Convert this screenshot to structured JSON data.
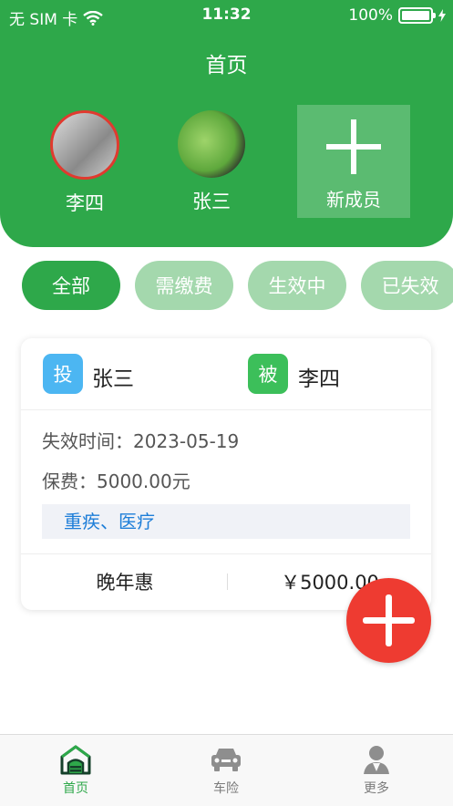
{
  "status_bar": {
    "carrier": "无 SIM 卡",
    "time": "11:32",
    "battery": "100%"
  },
  "header": {
    "title": "首页"
  },
  "members": [
    {
      "name": "李四"
    },
    {
      "name": "张三"
    }
  ],
  "add_member": {
    "label": "新成员"
  },
  "filters": [
    "全部",
    "需缴费",
    "生效中",
    "已失效"
  ],
  "policy_card": {
    "policyholder_badge": "投",
    "policyholder": "张三",
    "insured_badge": "被",
    "insured": "李四",
    "expiry": "失效时间：2023-05-19",
    "premium": "保费：5000.00元",
    "coverage": "重疾、医疗",
    "plan_name": "晚年惠",
    "price": "￥5000.00"
  },
  "tabbar": [
    {
      "label": "首页",
      "icon": "home-icon"
    },
    {
      "label": "车险",
      "icon": "car-icon"
    },
    {
      "label": "更多",
      "icon": "more-person-icon"
    }
  ],
  "colors": {
    "primary": "#2ea84a",
    "chip_inactive": "#a4d8ad",
    "fab": "#ee3b31",
    "badge_blue": "#4cb6f2",
    "badge_green": "#3cbf5a",
    "link": "#1e7ed8"
  }
}
